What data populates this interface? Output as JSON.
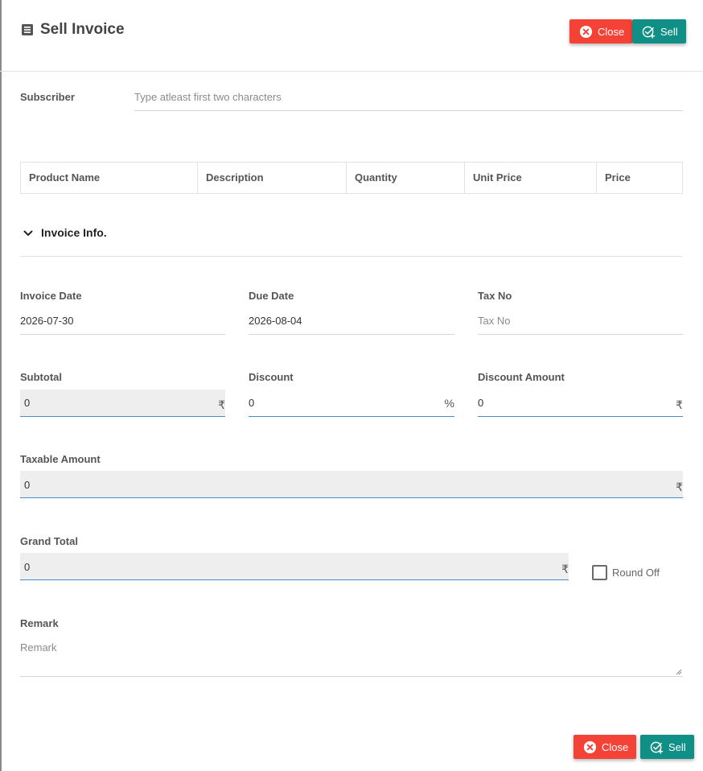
{
  "dialog": {
    "title": "Sell Invoice",
    "icon": "list-doc-icon",
    "close_label": "Close",
    "sell_label": "Sell"
  },
  "subscriber": {
    "label": "Subscriber",
    "placeholder": "Type atleast first two characters"
  },
  "products_table": {
    "columns": [
      "Product Name",
      "Description",
      "Quantity",
      "Unit Price",
      "Price"
    ]
  },
  "invoice_info": {
    "section_title": "Invoice Info.",
    "invoice_date_label": "Invoice Date",
    "invoice_date": "2026-07-30",
    "due_date_label": "Due Date",
    "due_date": "2026-08-04",
    "tax_no_label": "Tax No",
    "tax_no_placeholder": "Tax No",
    "subtotal_label": "Subtotal",
    "subtotal": "0",
    "discount_label": "Discount",
    "discount": "0",
    "discount_amount_label": "Discount Amount",
    "discount_amount": "0",
    "taxable_amount_label": "Taxable Amount",
    "taxable_amount": "0",
    "grand_total_label": "Grand Total",
    "grand_total": "0",
    "round_off_label": "Round Off",
    "round_off_checked": false,
    "remark_label": "Remark",
    "remark_placeholder": "Remark",
    "currency_symbol": "₹",
    "percent_symbol": "%"
  },
  "colors": {
    "close": "#f44336",
    "sell": "#0f8f86",
    "underline_active": "#4b8ed0",
    "readonly_bg": "#eeeeee"
  }
}
